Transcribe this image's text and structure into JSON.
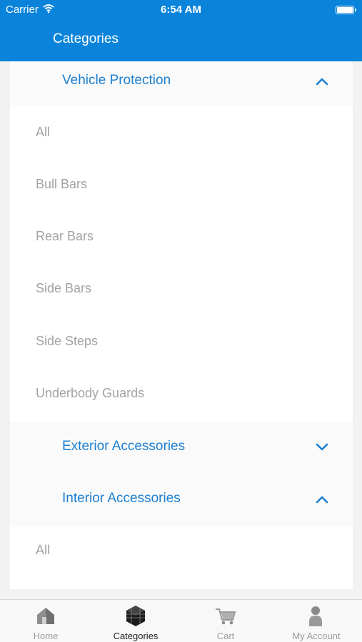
{
  "status_bar": {
    "carrier": "Carrier",
    "time": "6:54 AM"
  },
  "nav": {
    "title": "Categories"
  },
  "categories": [
    {
      "label": "Vehicle Protection",
      "expanded": true,
      "chevron": "chevron-up-icon",
      "items": [
        "All",
        "Bull Bars",
        "Rear Bars",
        "Side Bars",
        "Side Steps",
        "Underbody Guards"
      ]
    },
    {
      "label": "Exterior Accessories",
      "expanded": false,
      "chevron": "chevron-down-icon",
      "items": []
    },
    {
      "label": "Interior Accessories",
      "expanded": true,
      "chevron": "chevron-up-icon",
      "items": [
        "All"
      ]
    }
  ],
  "tabs": [
    {
      "label": "Home",
      "icon": "home-icon",
      "active": false
    },
    {
      "label": "Categories",
      "icon": "cube-icon",
      "active": true
    },
    {
      "label": "Cart",
      "icon": "cart-icon",
      "active": false
    },
    {
      "label": "My Account",
      "icon": "user-icon",
      "active": false
    }
  ],
  "colors": {
    "accent": "#0a84db",
    "category_text": "#1b7fd2",
    "item_text": "#a3a3a3",
    "tab_active": "#222222",
    "tab_inactive": "#9b9b9b"
  }
}
